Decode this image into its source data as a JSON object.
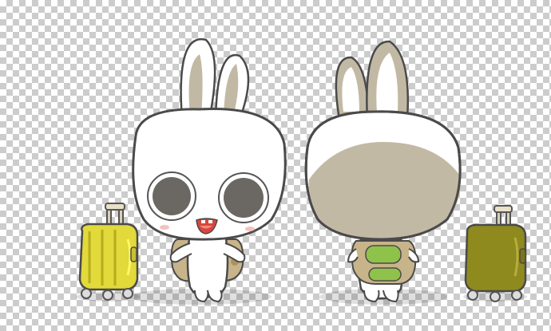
{
  "canvas": {
    "background": "transparency-checkerboard",
    "checker_light": "#ffffff",
    "checker_dark": "#cccccc"
  },
  "characters": [
    {
      "id": "bunny-front",
      "view": "front",
      "body_color": "#ffffff",
      "ear_inner_color": "#c2b9a4",
      "backpack_color": "#c8b48a"
    },
    {
      "id": "bunny-back",
      "view": "back",
      "head_patch_color": "#c2b9a4",
      "backpack_color": "#c8b48a",
      "backpack_accent": "#8fc24a"
    }
  ],
  "suitcases": [
    {
      "id": "suitcase-yellow",
      "color": "#e2d93a"
    },
    {
      "id": "suitcase-olive",
      "color": "#8f8a1e"
    }
  ],
  "outline_color": "#4a4a4a"
}
